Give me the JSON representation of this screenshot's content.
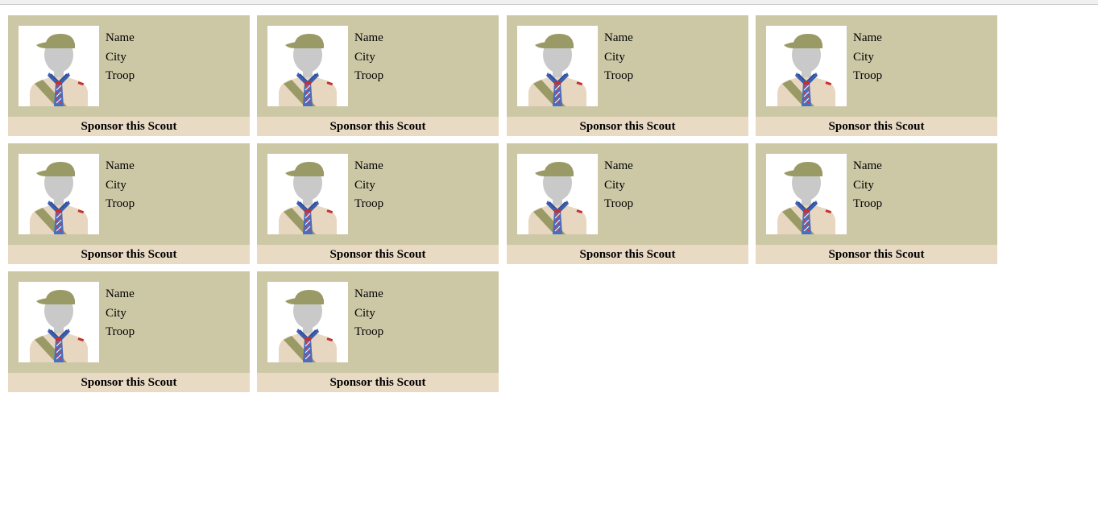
{
  "cards": [
    {
      "name_label": "Name",
      "city_label": "City",
      "troop_label": "Troop",
      "sponsor_label": "Sponsor this Scout",
      "avatar_icon": "scout-avatar-icon"
    },
    {
      "name_label": "Name",
      "city_label": "City",
      "troop_label": "Troop",
      "sponsor_label": "Sponsor this Scout",
      "avatar_icon": "scout-avatar-icon"
    },
    {
      "name_label": "Name",
      "city_label": "City",
      "troop_label": "Troop",
      "sponsor_label": "Sponsor this Scout",
      "avatar_icon": "scout-avatar-icon"
    },
    {
      "name_label": "Name",
      "city_label": "City",
      "troop_label": "Troop",
      "sponsor_label": "Sponsor this Scout",
      "avatar_icon": "scout-avatar-icon"
    },
    {
      "name_label": "Name",
      "city_label": "City",
      "troop_label": "Troop",
      "sponsor_label": "Sponsor this Scout",
      "avatar_icon": "scout-avatar-icon"
    },
    {
      "name_label": "Name",
      "city_label": "City",
      "troop_label": "Troop",
      "sponsor_label": "Sponsor this Scout",
      "avatar_icon": "scout-avatar-icon"
    },
    {
      "name_label": "Name",
      "city_label": "City",
      "troop_label": "Troop",
      "sponsor_label": "Sponsor this Scout",
      "avatar_icon": "scout-avatar-icon"
    },
    {
      "name_label": "Name",
      "city_label": "City",
      "troop_label": "Troop",
      "sponsor_label": "Sponsor this Scout",
      "avatar_icon": "scout-avatar-icon"
    },
    {
      "name_label": "Name",
      "city_label": "City",
      "troop_label": "Troop",
      "sponsor_label": "Sponsor this Scout",
      "avatar_icon": "scout-avatar-icon"
    },
    {
      "name_label": "Name",
      "city_label": "City",
      "troop_label": "Troop",
      "sponsor_label": "Sponsor this Scout",
      "avatar_icon": "scout-avatar-icon"
    }
  ],
  "colors": {
    "card_background": "#ccc8a6",
    "sponsor_bar": "#e9dac4",
    "photo_background": "#ffffff"
  }
}
